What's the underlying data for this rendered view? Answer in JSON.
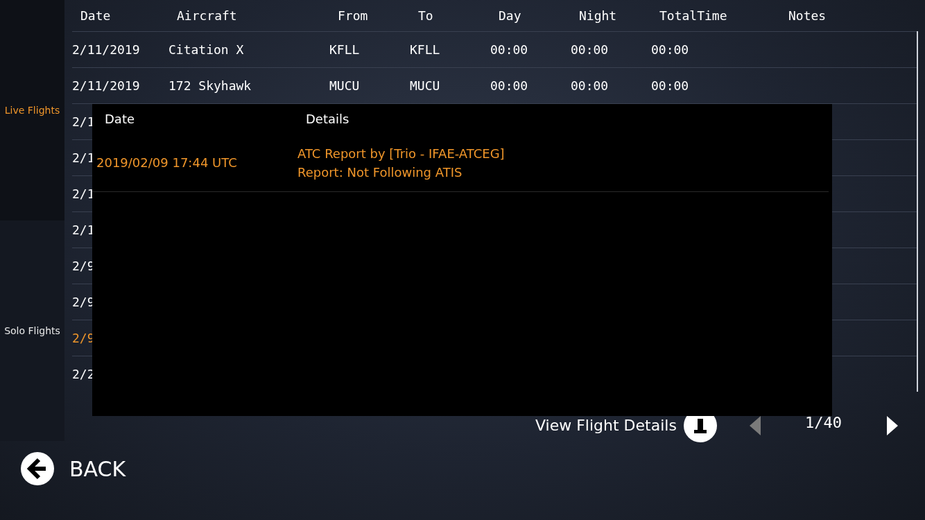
{
  "sidebar": {
    "items": [
      {
        "label": "Live Flights",
        "selected": true
      },
      {
        "label": "Solo Flights",
        "selected": false
      }
    ]
  },
  "table": {
    "columns": [
      "Date",
      "Aircraft",
      "From",
      "To",
      "Day",
      "Night",
      "TotalTime",
      "Notes"
    ],
    "rows": [
      {
        "cells": [
          "2/11/2019",
          "Citation X",
          "KFLL",
          "KFLL",
          "00:00",
          "00:00",
          "00:00"
        ],
        "selected": false
      },
      {
        "cells": [
          "2/11/2019",
          "172 Skyhawk",
          "MUCU",
          "MUCU",
          "00:00",
          "00:00",
          "00:00"
        ],
        "selected": false
      },
      {
        "cells": [
          "2/1"
        ],
        "selected": false
      },
      {
        "cells": [
          "2/1"
        ],
        "selected": false
      },
      {
        "cells": [
          "2/1"
        ],
        "selected": false
      },
      {
        "cells": [
          "2/1"
        ],
        "selected": false
      },
      {
        "cells": [
          "2/9"
        ],
        "selected": false
      },
      {
        "cells": [
          "2/9"
        ],
        "selected": false
      },
      {
        "cells": [
          "2/9"
        ],
        "selected": true
      },
      {
        "cells": [
          "2/2"
        ],
        "selected": false
      }
    ]
  },
  "dialog": {
    "columns": [
      "Date",
      "Details"
    ],
    "rows": [
      {
        "date": "2019/02/09 17:44 UTC",
        "details": [
          "ATC Report by [Trio - IFAE-ATCEG]",
          "Report: Not Following ATIS"
        ]
      }
    ]
  },
  "footer": {
    "view_details": "View Flight Details",
    "prev": {
      "disabled": true
    },
    "page": "1/40",
    "next": {
      "disabled": false
    }
  },
  "back": "BACK"
}
